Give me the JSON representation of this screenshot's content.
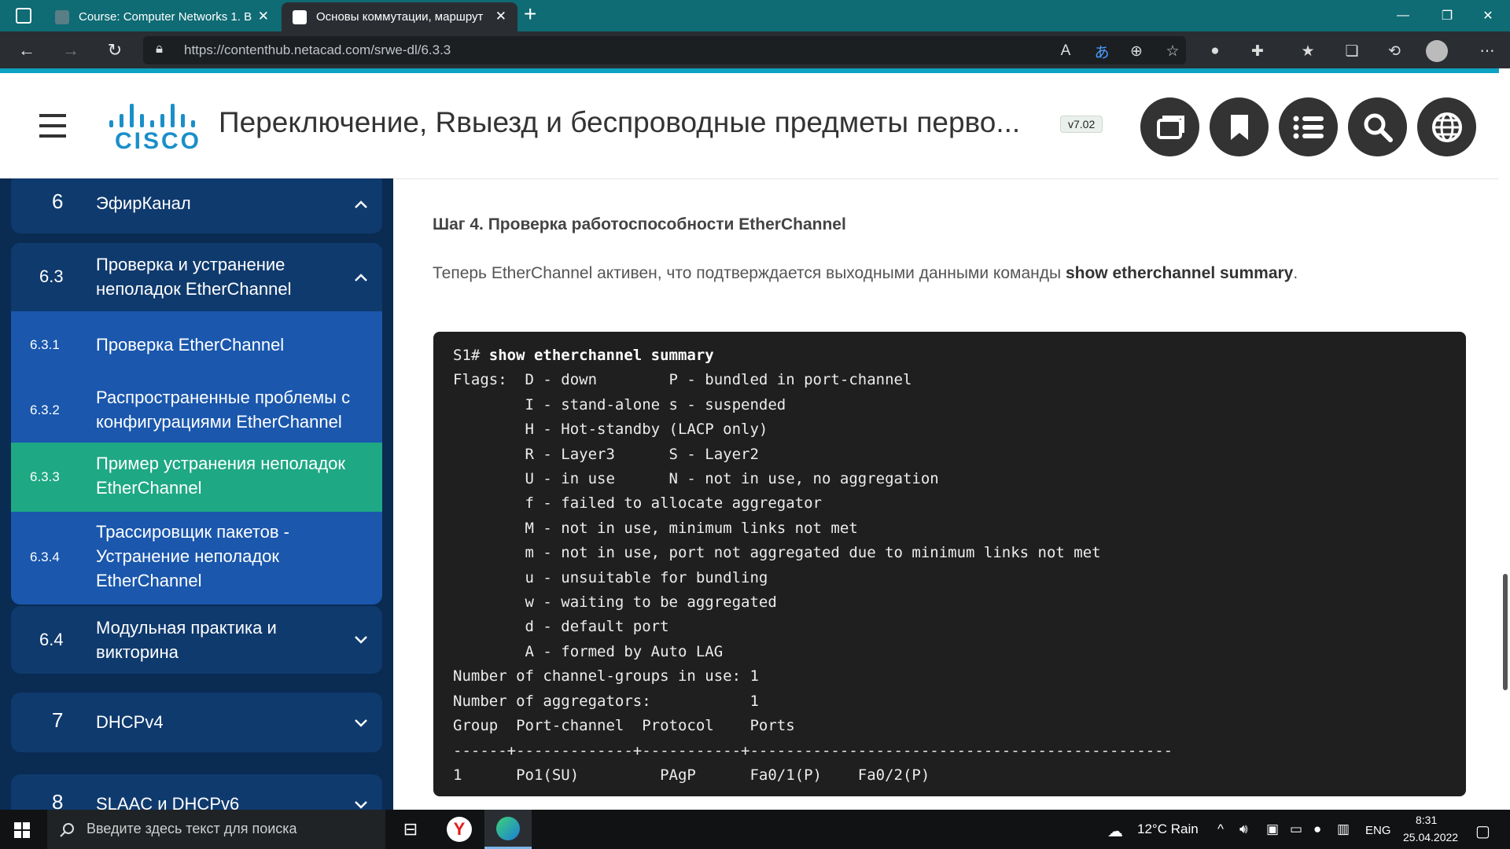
{
  "browser": {
    "tabs": [
      {
        "label": "Course: Computer Networks 1. B",
        "active": false
      },
      {
        "label": "Основы коммутации, маршрут",
        "active": true
      }
    ],
    "new_tab": "+",
    "url": "https://contenthub.netacad.com/srwe-dl/6.3.3",
    "window": {
      "minimize": "—",
      "maximize": "❐",
      "close": "✕"
    }
  },
  "header": {
    "logo": "CISCO",
    "title": "Переключение, Rвыезд и беспроводные предметы перво...",
    "version": "v7.02",
    "buttons": [
      "pages-icon",
      "bookmark-icon",
      "list-icon",
      "search-icon",
      "globe-icon"
    ]
  },
  "sidebar": {
    "module6": {
      "num": "6",
      "label": "ЭфирКанал"
    },
    "section63": {
      "num": "6.3",
      "label_line1": "Проверка и устранение",
      "label_line2": "неполадок EtherChannel"
    },
    "items": [
      {
        "num": "6.3.1",
        "lines": [
          "Проверка EtherChannel"
        ]
      },
      {
        "num": "6.3.2",
        "lines": [
          "Распространенные проблемы с",
          "конфигурациями EtherChannel"
        ]
      },
      {
        "num": "6.3.3",
        "lines": [
          "Пример устранения неполадок",
          "EtherChannel"
        ]
      },
      {
        "num": "6.3.4",
        "lines": [
          "Трассировщик пакетов -",
          "Устранение неполадок",
          "EtherChannel"
        ]
      }
    ],
    "section64": {
      "num": "6.4",
      "label_line1": "Модульная практика и",
      "label_line2": "викторина"
    },
    "module7": {
      "num": "7",
      "label": "DHCPv4"
    },
    "module8": {
      "num": "8",
      "label": "SLAAC и DHCPv6"
    }
  },
  "content": {
    "step_title": "Шаг 4. Проверка работоспособности EtherChannel",
    "para_text": "Теперь EtherChannel активен, что подтверждается выходными данными команды ",
    "para_bold": "show etherchannel summary",
    "para_end": ".",
    "terminal": {
      "prompt": "S1# ",
      "command": "show etherchannel summary",
      "lines": [
        "Flags:  D - down        P - bundled in port-channel",
        "        I - stand-alone s - suspended",
        "        H - Hot-standby (LACP only)",
        "        R - Layer3      S - Layer2",
        "        U - in use      N - not in use, no aggregation",
        "        f - failed to allocate aggregator",
        "        M - not in use, minimum links not met",
        "        m - not in use, port not aggregated due to minimum links not met",
        "        u - unsuitable for bundling",
        "        w - waiting to be aggregated",
        "        d - default port",
        "        A - formed by Auto LAG",
        "Number of channel-groups in use: 1",
        "Number of aggregators:           1",
        "Group  Port-channel  Protocol    Ports",
        "------+-------------+-----------+-----------------------------------------------",
        "1      Po1(SU)         PAgP      Fa0/1(P)    Fa0/2(P)"
      ]
    }
  },
  "taskbar": {
    "search_placeholder": "Введите здесь текст для поиска",
    "weather": "12°C  Rain",
    "lang": "ENG",
    "time": "8:31",
    "date": "25.04.2022"
  }
}
